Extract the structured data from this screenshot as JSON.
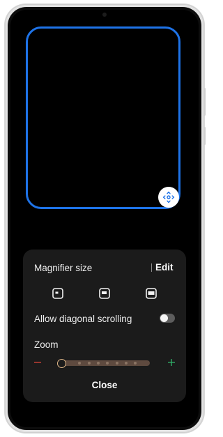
{
  "magnifier": {
    "move_handle_icon": "move-arrows-icon",
    "frame_color": "#1e73e8"
  },
  "panel": {
    "size_label": "Magnifier size",
    "edit_label": "Edit",
    "size_options": [
      {
        "icon": "small-window-icon"
      },
      {
        "icon": "medium-window-icon"
      },
      {
        "icon": "large-window-icon"
      }
    ],
    "diagonal_label": "Allow diagonal scrolling",
    "diagonal_enabled": false,
    "zoom_label": "Zoom",
    "zoom_level": 0,
    "zoom_steps": 7,
    "minus_color": "#d9453a",
    "plus_color": "#2fb36a",
    "close_label": "Close"
  }
}
